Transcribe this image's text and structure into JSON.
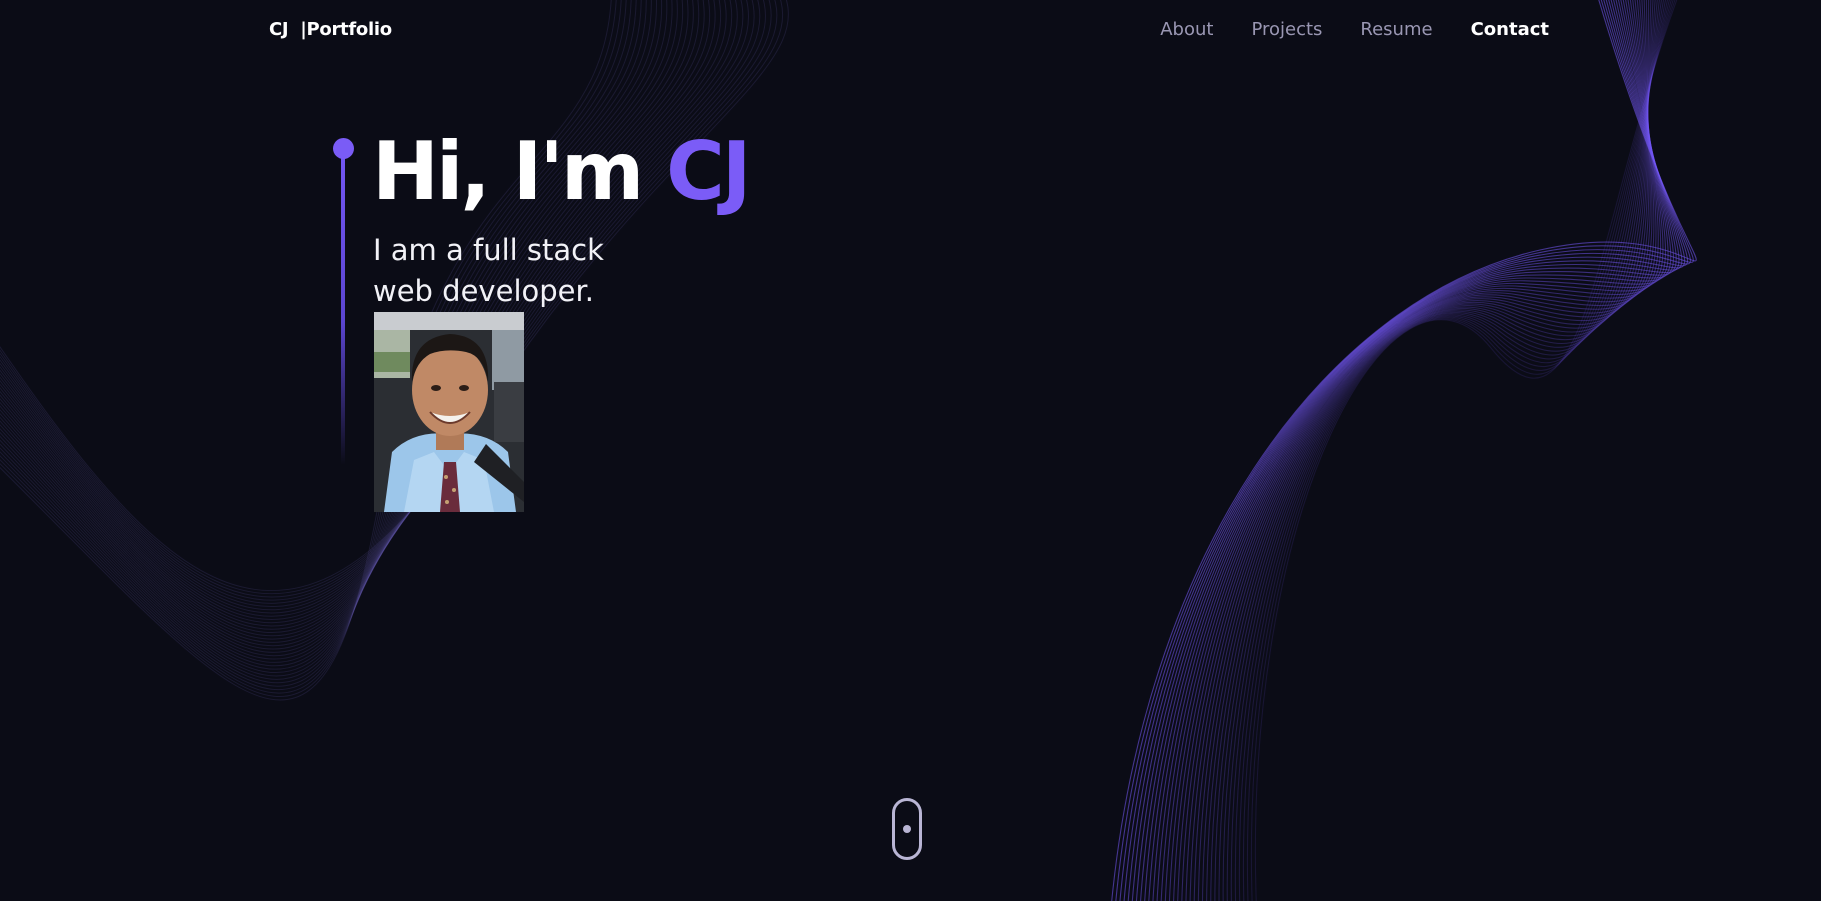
{
  "nav": {
    "brand": "CJ  |Portfolio",
    "links": [
      {
        "label": "About"
      },
      {
        "label": "Projects"
      },
      {
        "label": "Resume"
      },
      {
        "label": "Contact"
      }
    ]
  },
  "hero": {
    "greeting": "Hi, I'm",
    "name": "CJ",
    "subtitle": "I am a full stack web developer."
  },
  "theme": {
    "background": "#0b0c16",
    "accent": "#7b5cf7",
    "nav_text": "#9a97b3",
    "nav_active": "#ffffff"
  },
  "icons": {
    "scroll": "mouse-scroll-icon"
  }
}
